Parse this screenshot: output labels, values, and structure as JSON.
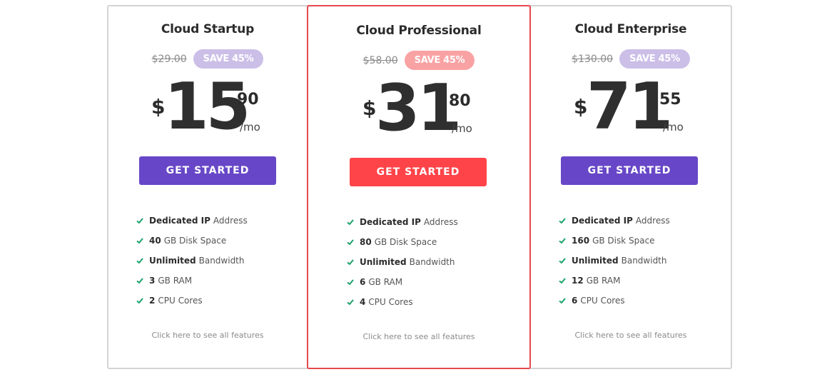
{
  "colors": {
    "accent_purple": "#6747c7",
    "accent_red": "#fe4449",
    "badge_purple": "#cbbfe8",
    "badge_red": "#f9a2a4",
    "featured_border": "#e5484d",
    "check_green": "#1aa16a"
  },
  "plans": [
    {
      "name": "Cloud Startup",
      "old_price": "$29.00",
      "save_badge": "SAVE 45%",
      "currency": "$",
      "dollars": "15",
      "cents": "90",
      "period": "/mo",
      "cta": "GET STARTED",
      "featured": false,
      "features": [
        {
          "bold": "Dedicated IP",
          "rest": "Address"
        },
        {
          "bold": "40",
          "rest": "GB Disk Space"
        },
        {
          "bold": "Unlimited",
          "rest": "Bandwidth"
        },
        {
          "bold": "3",
          "rest": "GB RAM"
        },
        {
          "bold": "2",
          "rest": "CPU Cores"
        }
      ],
      "see_all": "Click here to see all features"
    },
    {
      "name": "Cloud Professional",
      "old_price": "$58.00",
      "save_badge": "SAVE 45%",
      "currency": "$",
      "dollars": "31",
      "cents": "80",
      "period": "/mo",
      "cta": "GET STARTED",
      "featured": true,
      "features": [
        {
          "bold": "Dedicated IP",
          "rest": "Address"
        },
        {
          "bold": "80",
          "rest": "GB Disk Space"
        },
        {
          "bold": "Unlimited",
          "rest": "Bandwidth"
        },
        {
          "bold": "6",
          "rest": "GB RAM"
        },
        {
          "bold": "4",
          "rest": "CPU Cores"
        }
      ],
      "see_all": "Click here to see all features"
    },
    {
      "name": "Cloud Enterprise",
      "old_price": "$130.00",
      "save_badge": "SAVE 45%",
      "currency": "$",
      "dollars": "71",
      "cents": "55",
      "period": "/mo",
      "cta": "GET STARTED",
      "featured": false,
      "features": [
        {
          "bold": "Dedicated IP",
          "rest": "Address"
        },
        {
          "bold": "160",
          "rest": "GB Disk Space"
        },
        {
          "bold": "Unlimited",
          "rest": "Bandwidth"
        },
        {
          "bold": "12",
          "rest": "GB RAM"
        },
        {
          "bold": "6",
          "rest": "CPU Cores"
        }
      ],
      "see_all": "Click here to see all features"
    }
  ]
}
